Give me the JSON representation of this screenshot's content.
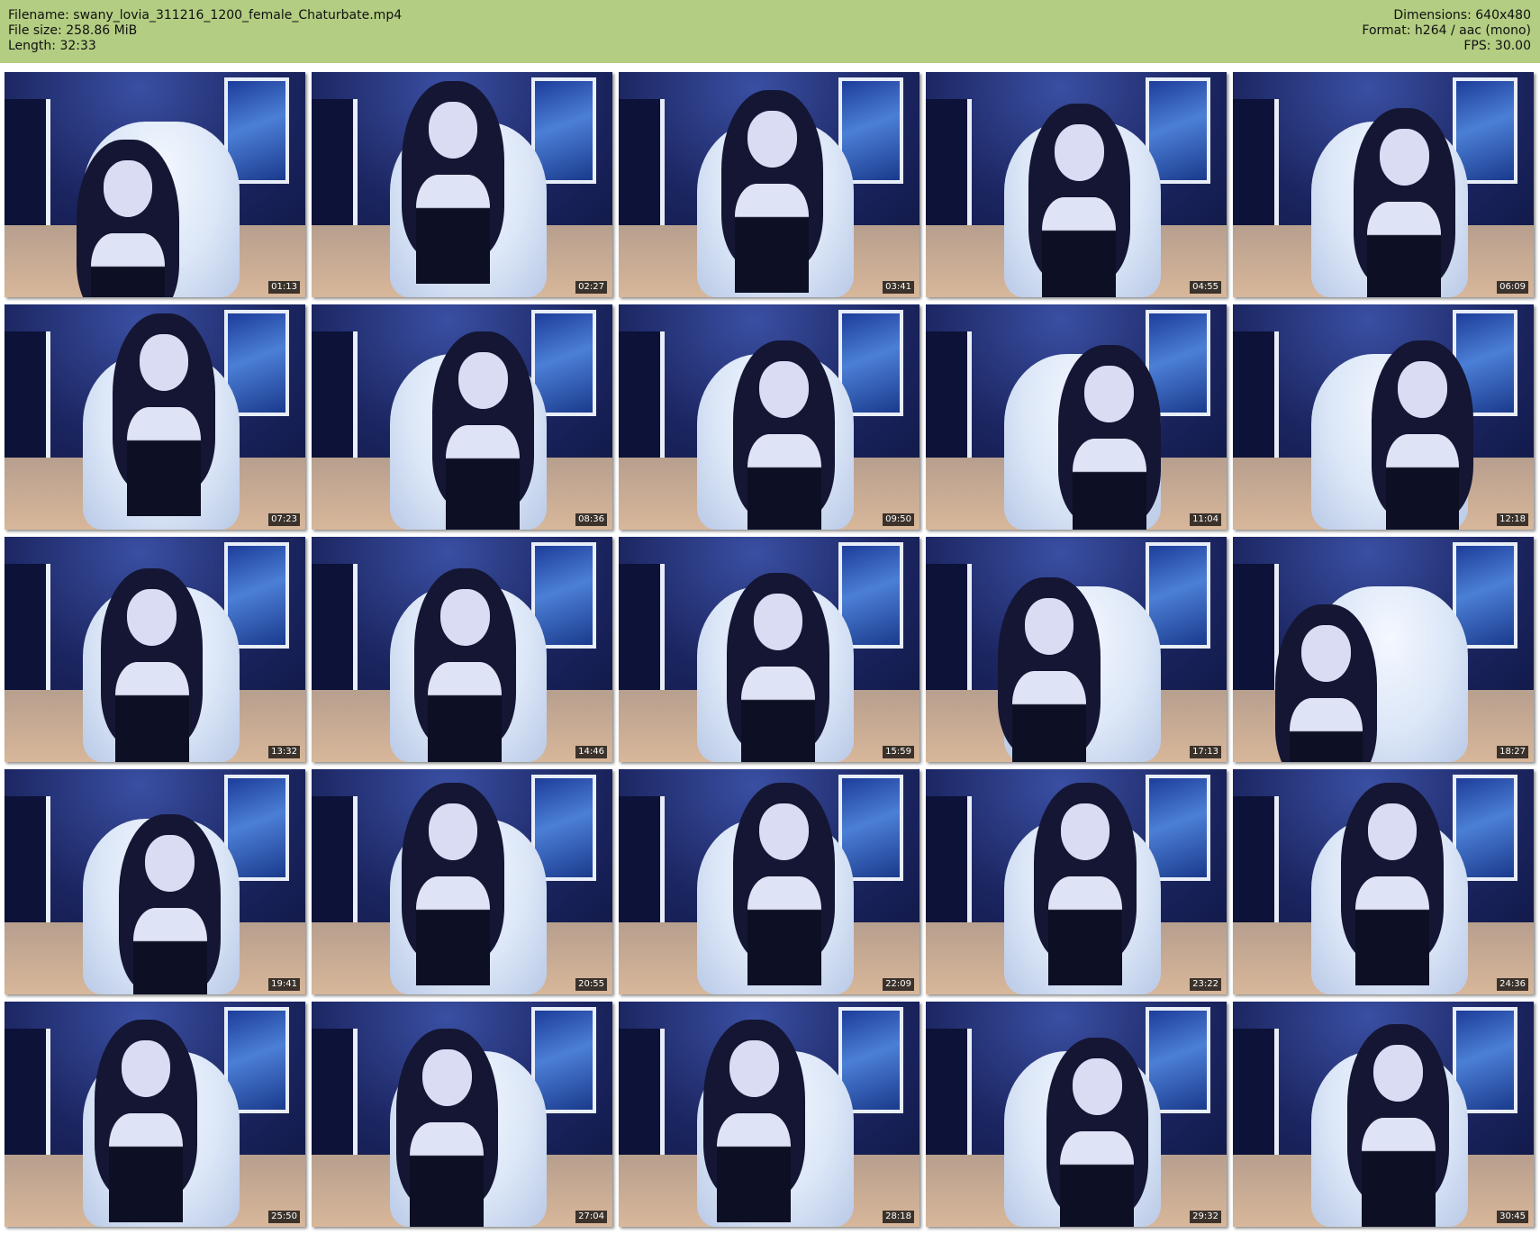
{
  "header": {
    "filename_label": "Filename: swany_lovia_311216_1200_female_Chaturbate.mp4",
    "filesize_label": "File size: 258.86 MiB",
    "length_label": "Length: 32:33",
    "dimensions_label": "Dimensions: 640x480",
    "format_label": "Format: h264 / aac (mono)",
    "fps_label": "FPS: 30.00",
    "background_color": "#b3cd82"
  },
  "thumbnails": [
    {
      "timestamp": "01:13"
    },
    {
      "timestamp": "02:27"
    },
    {
      "timestamp": "03:41"
    },
    {
      "timestamp": "04:55"
    },
    {
      "timestamp": "06:09"
    },
    {
      "timestamp": "07:23"
    },
    {
      "timestamp": "08:36"
    },
    {
      "timestamp": "09:50"
    },
    {
      "timestamp": "11:04"
    },
    {
      "timestamp": "12:18"
    },
    {
      "timestamp": "13:32"
    },
    {
      "timestamp": "14:46"
    },
    {
      "timestamp": "15:59"
    },
    {
      "timestamp": "17:13"
    },
    {
      "timestamp": "18:27"
    },
    {
      "timestamp": "19:41"
    },
    {
      "timestamp": "20:55"
    },
    {
      "timestamp": "22:09"
    },
    {
      "timestamp": "23:22"
    },
    {
      "timestamp": "24:36"
    },
    {
      "timestamp": "25:50"
    },
    {
      "timestamp": "27:04"
    },
    {
      "timestamp": "28:18"
    },
    {
      "timestamp": "29:32"
    },
    {
      "timestamp": "30:45"
    }
  ]
}
